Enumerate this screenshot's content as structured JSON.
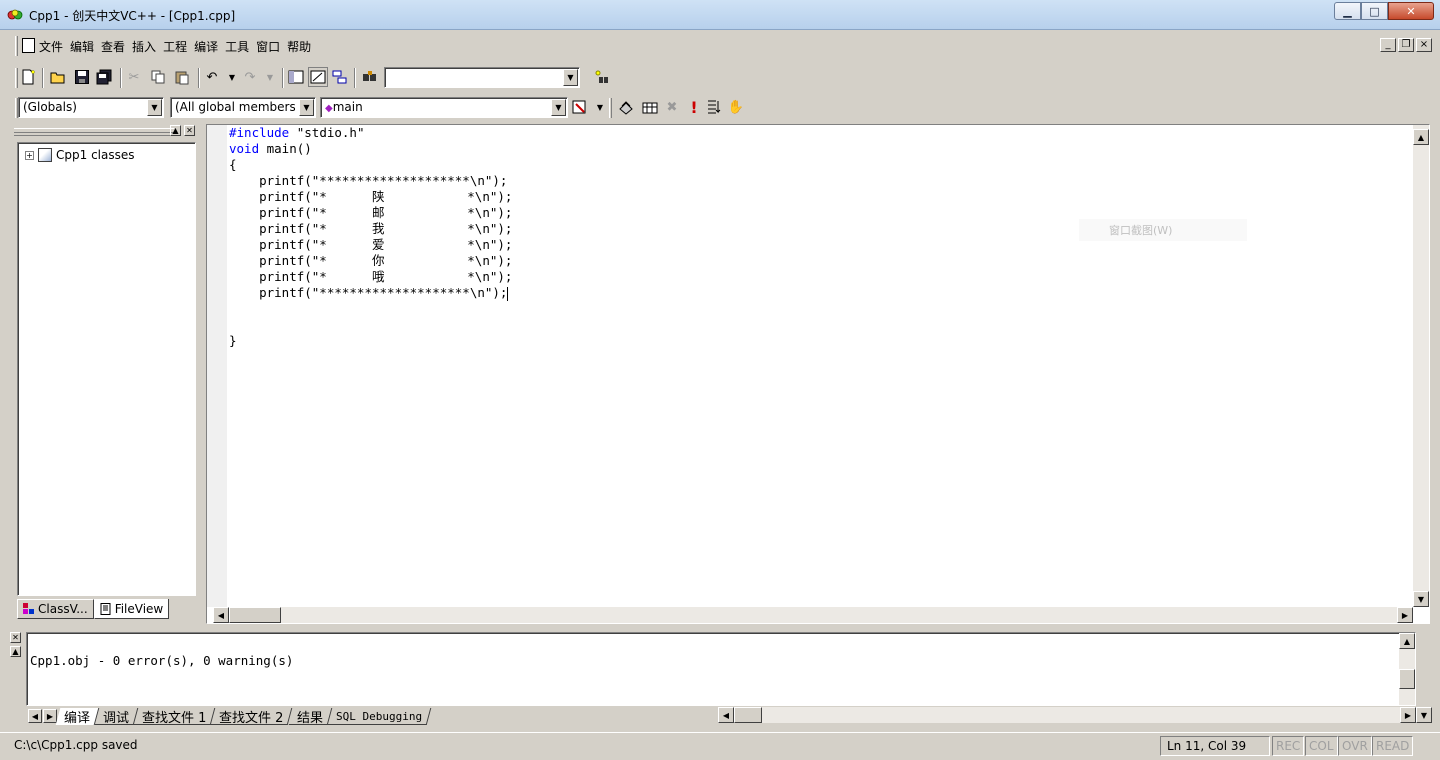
{
  "window": {
    "title": "Cpp1 - 创天中文VC++ - [Cpp1.cpp]",
    "minimize": "▁",
    "maximize": "□",
    "close": "✕"
  },
  "menubar": {
    "items": [
      "文件",
      "编辑",
      "查看",
      "插入",
      "工程",
      "编译",
      "工具",
      "窗口",
      "帮助"
    ],
    "mdi": [
      "_",
      "❐",
      "×"
    ]
  },
  "toolbar": {
    "find_combo_value": "",
    "globals_combo": "(Globals)",
    "members_combo": "(All global members",
    "function_combo": "main"
  },
  "workspace": {
    "tree_root": "Cpp1 classes",
    "expander": "+",
    "tabs": [
      "ClassV...",
      "FileView"
    ]
  },
  "editor": {
    "lines": [
      {
        "kw": "#include",
        "rest": " \"stdio.h\""
      },
      {
        "kw": "void",
        "rest": " main()"
      },
      {
        "kw": "",
        "rest": "{"
      },
      {
        "kw": "",
        "rest": "    printf(\"********************\\n\");"
      },
      {
        "kw": "",
        "rest": "    printf(\"*      陕           *\\n\");"
      },
      {
        "kw": "",
        "rest": "    printf(\"*      邮           *\\n\");"
      },
      {
        "kw": "",
        "rest": "    printf(\"*      我           *\\n\");"
      },
      {
        "kw": "",
        "rest": "    printf(\"*      爱           *\\n\");"
      },
      {
        "kw": "",
        "rest": "    printf(\"*      你           *\\n\");"
      },
      {
        "kw": "",
        "rest": "    printf(\"*      哦           *\\n\");"
      },
      {
        "kw": "",
        "rest": "    printf(\"********************\\n\");"
      },
      {
        "kw": "",
        "rest": ""
      },
      {
        "kw": "",
        "rest": ""
      },
      {
        "kw": "",
        "rest": "}"
      }
    ],
    "ghost_overlay": "窗口截图(W)"
  },
  "output": {
    "message": "Cpp1.obj - 0 error(s), 0 warning(s)",
    "tabs": [
      "编译",
      "调试",
      "查找文件 1",
      "查找文件 2",
      "结果",
      "SQL Debugging"
    ]
  },
  "statusbar": {
    "message": "C:\\c\\Cpp1.cpp saved",
    "position": "Ln 11, Col 39",
    "indicators": [
      "REC",
      "COL",
      "OVR",
      "READ"
    ]
  },
  "colors": {
    "keyword": "#0000ff",
    "chrome": "#d4d0c8",
    "titlebar": "#b7d0ec"
  }
}
